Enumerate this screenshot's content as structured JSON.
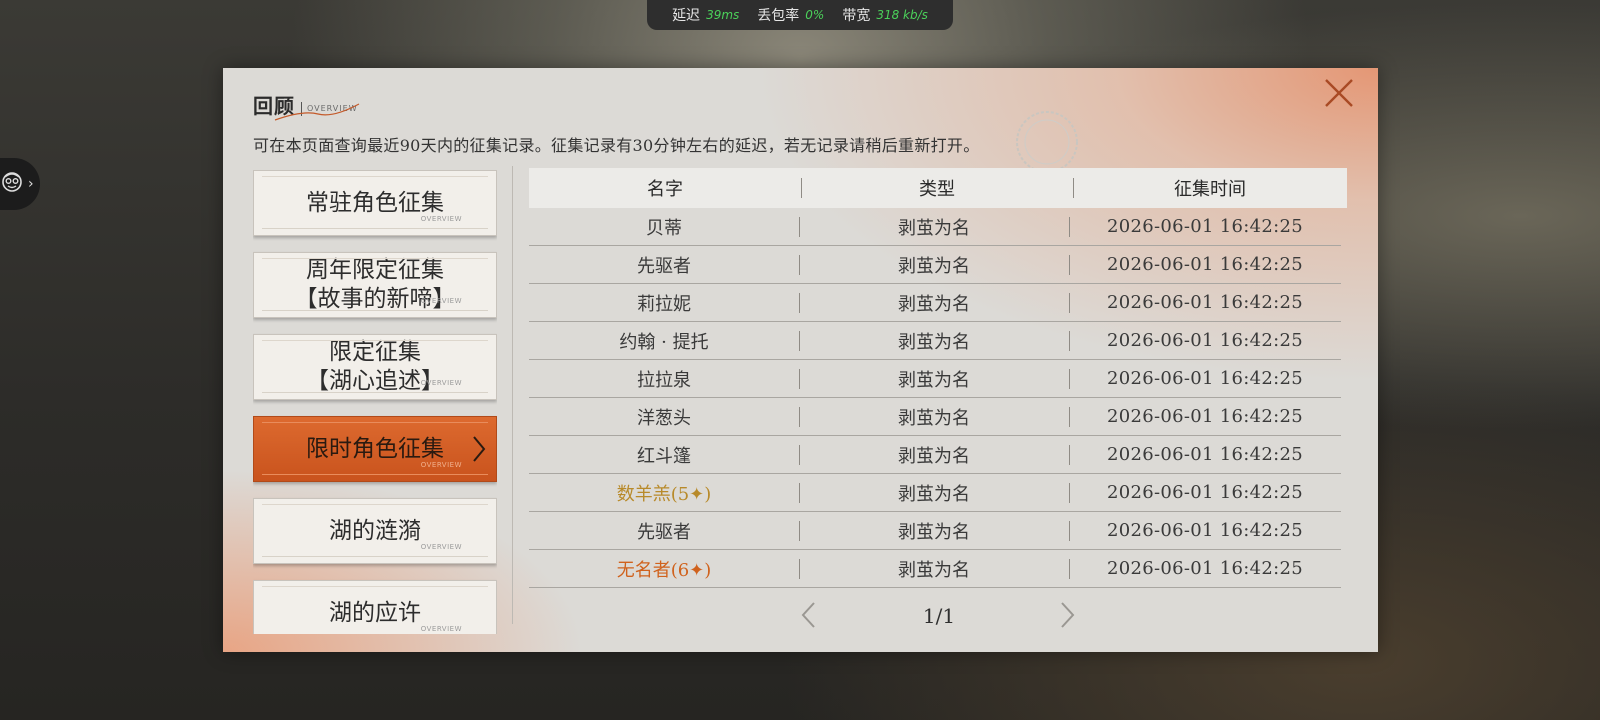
{
  "status_bar": {
    "latency_label": "延迟",
    "latency_value": "39ms",
    "loss_label": "丢包率",
    "loss_value": "0%",
    "bandwidth_label": "带宽",
    "bandwidth_value": "318 kb/s",
    "value_color": "#4bd15a"
  },
  "side_tab": {
    "icon": "assistant-face-icon"
  },
  "modal": {
    "title": "回顾",
    "subtitle": "OVERVIEW",
    "description": "可在本页面查询最近90天内的征集记录。征集记录有30分钟左右的延迟，若无记录请稍后重新打开。",
    "close_icon": "close-icon"
  },
  "categories": [
    {
      "line1": "常驻角色征集",
      "line2": "",
      "tag": "OVERVIEW",
      "active": false
    },
    {
      "line1": "周年限定征集",
      "line2": "【故事的新啼】",
      "tag": "OVERVIEW",
      "active": false
    },
    {
      "line1": "限定征集",
      "line2": "【湖心追述】",
      "tag": "OVERVIEW",
      "active": false
    },
    {
      "line1": "限时角色征集",
      "line2": "",
      "tag": "OVERVIEW",
      "active": true
    },
    {
      "line1": "湖的涟漪",
      "line2": "",
      "tag": "OVERVIEW",
      "active": false
    },
    {
      "line1": "湖的应许",
      "line2": "",
      "tag": "OVERVIEW",
      "active": false
    }
  ],
  "table": {
    "headers": {
      "name": "名字",
      "type": "类型",
      "time": "征集时间"
    },
    "rows": [
      {
        "name": "贝蒂",
        "type": "剥茧为名",
        "time": "2026-06-01 16:42:25",
        "style": ""
      },
      {
        "name": "先驱者",
        "type": "剥茧为名",
        "time": "2026-06-01 16:42:25",
        "style": ""
      },
      {
        "name": "莉拉妮",
        "type": "剥茧为名",
        "time": "2026-06-01 16:42:25",
        "style": ""
      },
      {
        "name": "约翰 · 提托",
        "type": "剥茧为名",
        "time": "2026-06-01 16:42:25",
        "style": ""
      },
      {
        "name": "拉拉泉",
        "type": "剥茧为名",
        "time": "2026-06-01 16:42:25",
        "style": ""
      },
      {
        "name": "洋葱头",
        "type": "剥茧为名",
        "time": "2026-06-01 16:42:25",
        "style": ""
      },
      {
        "name": "红斗篷",
        "type": "剥茧为名",
        "time": "2026-06-01 16:42:25",
        "style": ""
      },
      {
        "name": "数羊羔(5✦)",
        "type": "剥茧为名",
        "time": "2026-06-01 16:42:25",
        "style": "gold"
      },
      {
        "name": "先驱者",
        "type": "剥茧为名",
        "time": "2026-06-01 16:42:25",
        "style": ""
      },
      {
        "name": "无名者(6✦)",
        "type": "剥茧为名",
        "time": "2026-06-01 16:42:25",
        "style": "orange"
      }
    ]
  },
  "pagination": {
    "page_text": "1/1"
  }
}
